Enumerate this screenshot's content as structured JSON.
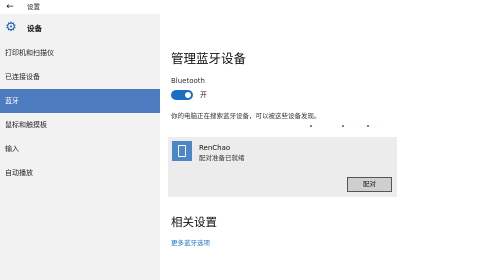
{
  "window": {
    "back_icon": "back-arrow-icon",
    "title": "设置"
  },
  "sidebar": {
    "header_icon": "gear-icon",
    "header_label": "设备",
    "items": [
      {
        "label": "打印机和扫描仪",
        "selected": false
      },
      {
        "label": "已连接设备",
        "selected": false
      },
      {
        "label": "蓝牙",
        "selected": true
      },
      {
        "label": "鼠标和触摸板",
        "selected": false
      },
      {
        "label": "输入",
        "selected": false
      },
      {
        "label": "自动播放",
        "selected": false
      }
    ]
  },
  "main": {
    "title": "管理蓝牙设备",
    "bluetooth_label": "Bluetooth",
    "toggle_on": true,
    "toggle_state": "开",
    "status_text": "你的电脑正在搜索蓝牙设备，可以被这些设备发现。",
    "device": {
      "icon": "tablet-icon",
      "name": "RenChao",
      "status": "配对准备已就绪",
      "pair_label": "配对"
    },
    "related_title": "相关设置",
    "more_link": "更多蓝牙选项"
  },
  "colors": {
    "accent": "#1a6fc4",
    "selected_bg": "#4c7bbf",
    "sidebar_bg": "#f2f2f2",
    "card_bg": "#ececec"
  }
}
